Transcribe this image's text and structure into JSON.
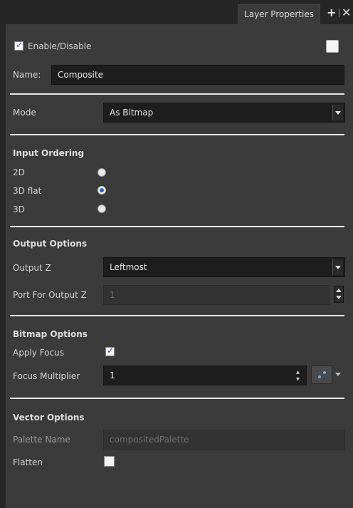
{
  "tabs": {
    "title": "Layer Properties"
  },
  "enable": {
    "label": "Enable/Disable",
    "checked": true
  },
  "name": {
    "label": "Name:",
    "value": "Composite"
  },
  "mode": {
    "label": "Mode",
    "value": "As Bitmap"
  },
  "input_ordering": {
    "title": "Input Ordering",
    "options": [
      {
        "label": "2D",
        "selected": false
      },
      {
        "label": "3D flat",
        "selected": true
      },
      {
        "label": "3D",
        "selected": false
      }
    ]
  },
  "output_options": {
    "title": "Output Options",
    "output_z_label": "Output Z",
    "output_z_value": "Leftmost",
    "port_label": "Port For Output Z",
    "port_value": "1"
  },
  "bitmap_options": {
    "title": "Bitmap Options",
    "apply_focus_label": "Apply Focus",
    "apply_focus_checked": true,
    "focus_multiplier_label": "Focus Multiplier",
    "focus_multiplier_value": "1"
  },
  "vector_options": {
    "title": "Vector Options",
    "palette_name_label": "Palette Name",
    "palette_name_placeholder": "compositedPalette",
    "flatten_label": "Flatten",
    "flatten_checked": false
  },
  "colors": {
    "accent": "#2e5fcf",
    "panel": "#3b3b3b",
    "field": "#1e1e1e"
  }
}
